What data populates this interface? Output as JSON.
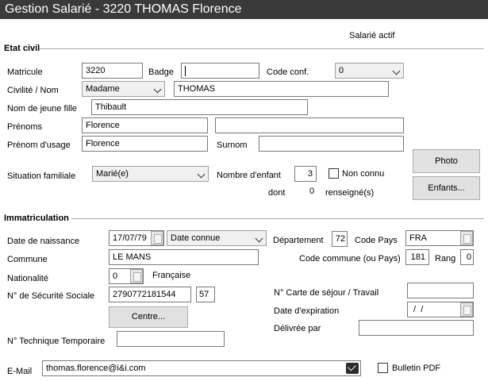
{
  "window": {
    "title": "Gestion Salarié - 3220 THOMAS Florence"
  },
  "status": "Salarié actif",
  "etat_civil": {
    "section_title": "Etat civil",
    "matricule_label": "Matricule",
    "matricule": "3220",
    "badge_label": "Badge",
    "badge": "",
    "code_conf_label": "Code conf.",
    "code_conf": "0",
    "civilite_label": "Civilité /  Nom",
    "civilite": "Madame",
    "nom": "THOMAS",
    "nom_jeune_fille_label": "Nom de jeune fille",
    "nom_jeune_fille": "Thibault",
    "prenoms_label": "Prénoms",
    "prenoms": "Florence",
    "prenoms2": "",
    "prenom_usage_label": "Prénom d'usage",
    "prenom_usage": "Florence",
    "surnom_label": "Surnom",
    "surnom": "",
    "situation_label": "Situation familiale",
    "situation": "Marié(e)",
    "nb_enfant_label": "Nombre d'enfant",
    "nb_enfant": "3",
    "non_connu_label": "Non connu",
    "dont_label": "dont",
    "dont_value": "0",
    "renseigne_label": "renseigné(s)",
    "photo_button": "Photo",
    "enfants_button": "Enfants..."
  },
  "immatriculation": {
    "section_title": "Immatriculation",
    "date_naissance_label": "Date de naissance",
    "date_naissance": "17/07/79",
    "date_type": "Date connue",
    "departement_label": "Département",
    "departement": "72",
    "code_pays_label": "Code Pays",
    "code_pays": "FRA",
    "commune_label": "Commune",
    "commune": "LE MANS",
    "code_commune_label": "Code commune (ou Pays)",
    "code_commune": "181",
    "rang_label": "Rang",
    "rang": "0",
    "nationalite_label": "Nationalité",
    "nationalite_code": "0",
    "nationalite": "Française",
    "secu_label": "N° de Sécurité Sociale",
    "secu": "2790772181544",
    "secu_cle": "57",
    "centre_button": "Centre...",
    "carte_sejour_label": "N° Carte de séjour / Travail",
    "carte_sejour": "",
    "date_expiration_label": "Date d'expiration",
    "date_expiration": " /  /",
    "delivree_label": "Délivrée par",
    "delivree": "",
    "ntt_label": "N° Technique Temporaire",
    "ntt": ""
  },
  "contact": {
    "email_label": "E-Mail",
    "email": "thomas.florence@i&i.com",
    "bulletin_pdf_label": "Bulletin PDF"
  }
}
